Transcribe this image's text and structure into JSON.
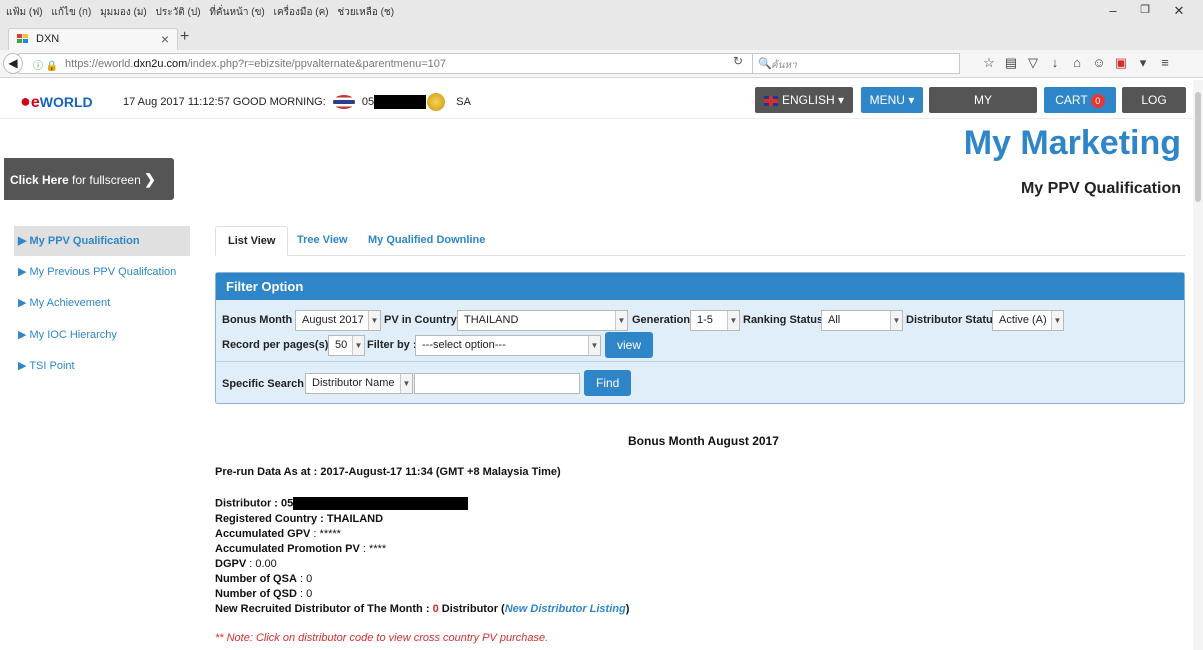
{
  "browser": {
    "menus": [
      "แฟ้ม (ฟ)",
      "แก้ไข (ก)",
      "มุมมอง (ม)",
      "ประวัติ (ป)",
      "ที่คั่นหน้า (ข)",
      "เครื่องมือ (ค)",
      "ช่วยเหลือ (ช)"
    ],
    "tab_title": "DXN",
    "url_prefix": "https://eworld.",
    "url_domain": "dxn2u.com",
    "url_path": "/index.php?r=ebizsite/ppvalternate&parentmenu=107",
    "search_placeholder": "ค้นหา"
  },
  "header": {
    "logo_text": "WORLD",
    "datetime": "17 Aug 2017 11:12:57",
    "greeting": "GOOD MORNING:",
    "user_code_prefix": "05",
    "user_suffix": "SA",
    "language_label": "ENGLISH",
    "menu_label": "MENU",
    "dashboard_label": "MY DASHBOARD",
    "cart_label": "CART",
    "cart_count": "0",
    "logout_label": "LOG OUT"
  },
  "page": {
    "title": "My Marketing",
    "subtitle": "My PPV Qualification",
    "fullscreen_bold": "Click Here",
    "fullscreen_rest": "for fullscreen"
  },
  "sidebar": {
    "items": [
      {
        "label": "My PPV Qualification"
      },
      {
        "label": "My Previous PPV Qualifcation"
      },
      {
        "label": "My Achievement"
      },
      {
        "label": "My IOC Hierarchy"
      },
      {
        "label": "TSI Point"
      }
    ]
  },
  "tabs": [
    "List View",
    "Tree View",
    "My Qualified Downline"
  ],
  "filter": {
    "heading": "Filter Option",
    "bonus_month_label": "Bonus Month :",
    "bonus_month_value": "August 2017",
    "pv_country_label": "PV in Country :",
    "pv_country_value": "THAILAND",
    "generation_label": "Generation :",
    "generation_value": "1-5",
    "ranking_label": "Ranking Status :",
    "ranking_value": "All",
    "distributor_status_label": "Distributor Status :",
    "distributor_status_value": "Active (A)",
    "records_label": "Record per pages(s) :",
    "records_value": "50",
    "filter_by_label": "Filter by :",
    "filter_by_value": "---select option---",
    "view_button": "view",
    "specific_label": "Specific Search :",
    "specific_value": "Distributor Name",
    "search_value": "",
    "find_button": "Find"
  },
  "report": {
    "bonus_month_title": "Bonus Month August 2017",
    "prerun": "Pre-run Data As at : 2017-August-17 11:34 (GMT +8 Malaysia Time)",
    "distributor_label": "Distributor : 05",
    "registered_country": "Registered Country : THAILAND",
    "acc_gpv_label": "Accumulated GPV",
    "acc_gpv_value": ": *****",
    "acc_promo_label": "Accumulated Promotion PV",
    "acc_promo_value": ": ****",
    "dgpv_label": "DGPV",
    "dgpv_value": ": 0.00",
    "qsa_label": "Number of QSA",
    "qsa_value": ": 0",
    "qsd_label": "Number of QSD",
    "qsd_value": ": 0",
    "new_recruited_label": "New Recruited Distributor of The Month :",
    "new_recruited_count": "0",
    "new_recruited_unit": "Distributor (",
    "new_listing_link": "New Distributor Listing",
    "new_recruited_close": ")",
    "note": "** Note: Click on distributor code to view cross country PV purchase."
  },
  "colors": {
    "accent": "#2e86c9",
    "panel_bg": "#dfeef8",
    "dark_button": "#555555",
    "cart_badge": "#e53935",
    "note_red": "#d32f2f"
  }
}
